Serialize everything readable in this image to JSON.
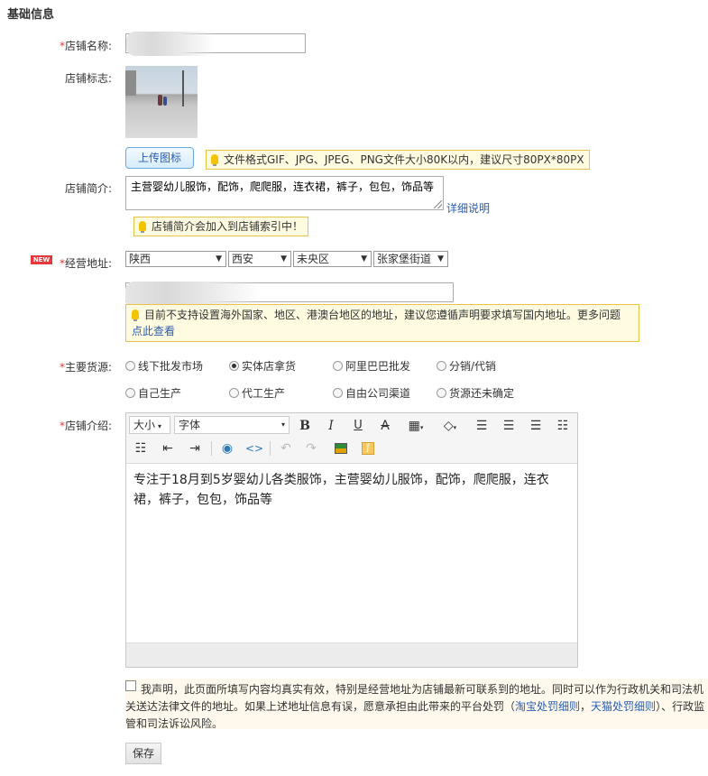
{
  "section_title": "基础信息",
  "required_mark": "*",
  "new_badge": "NEW",
  "shop_name": {
    "label": "店铺名称:",
    "value": ""
  },
  "shop_logo": {
    "label": "店铺标志:",
    "upload_button": "上传图标",
    "tip": "文件格式GIF、JPG、JPEG、PNG文件大小80K以内，建议尺寸80PX*80PX"
  },
  "shop_intro": {
    "label": "店铺简介:",
    "value": "主营婴幼儿服饰，配饰，爬爬服，连衣裙，裤子，包包，饰品等",
    "detail_link": "详细说明",
    "tip": "店铺简介会加入到店铺索引中！"
  },
  "address": {
    "label": "经营地址:",
    "province": "陕西",
    "city": "西安",
    "district": "未央区",
    "street": "张家堡街道",
    "detail": "",
    "tip_line1": "目前不支持设置海外国家、地区、港澳台地区的地址，建议您遵循声明要求填写国内地址。更多问题",
    "tip_link": "点此查看"
  },
  "goods_source": {
    "label": "主要货源:",
    "options": [
      "线下批发市场",
      "实体店拿货",
      "阿里巴巴批发",
      "分销/代销",
      "自己生产",
      "代工生产",
      "自由公司渠道",
      "货源还未确定"
    ],
    "selected_index": 1
  },
  "shop_desc": {
    "label": "店铺介绍:",
    "toolbar": {
      "size": "大小",
      "font": "字体"
    },
    "content": "专注于18月到5岁婴幼儿各类服饰，主营婴幼儿服饰，配饰，爬爬服，连衣裙，裤子，包包，饰品等"
  },
  "declaration": {
    "part1": "我声明，此页面所填写内容均真实有效，特别是经营地址为店铺最新可联系到的地址。同时可以作为行政机关和司法机关送达法律文件的地址。如果上述地址信息有误，愿意承担由此带来的平台处罚（",
    "link1": "淘宝处罚细则",
    "comma": "，",
    "link2": "天猫处罚细则",
    "part2": "）、行政监管和司法诉讼风险。"
  },
  "save_button": "保存",
  "colors": {
    "required": "#e4393c",
    "link": "#2a5db0",
    "tip_bg": "#fffbe0",
    "tip_border": "#e8c34a",
    "new_badge": "#e4393c"
  }
}
